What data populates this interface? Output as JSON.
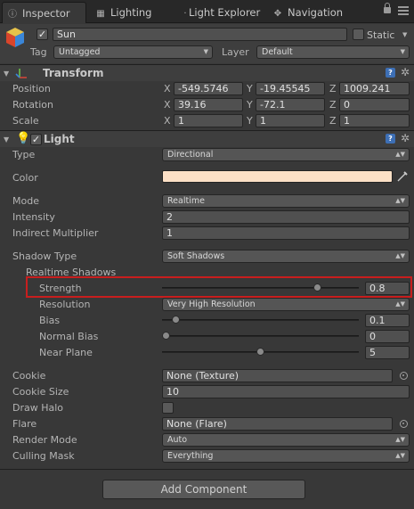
{
  "tabs": {
    "inspector": "Inspector",
    "lighting": "Lighting",
    "light_explorer": "Light Explorer",
    "navigation": "Navigation"
  },
  "object": {
    "name": "Sun",
    "active": true,
    "static_label": "Static",
    "static": false,
    "tag_label": "Tag",
    "tag_value": "Untagged",
    "layer_label": "Layer",
    "layer_value": "Default"
  },
  "transform": {
    "title": "Transform",
    "position_label": "Position",
    "rotation_label": "Rotation",
    "scale_label": "Scale",
    "axes": [
      "X",
      "Y",
      "Z"
    ],
    "position": [
      "-549.5746",
      "-19.45545",
      "1009.241"
    ],
    "rotation": [
      "39.16",
      "-72.1",
      "0"
    ],
    "scale": [
      "1",
      "1",
      "1"
    ]
  },
  "light": {
    "title": "Light",
    "enabled": true,
    "type_label": "Type",
    "type_value": "Directional",
    "color_label": "Color",
    "color_value": "#fce0c6",
    "mode_label": "Mode",
    "mode_value": "Realtime",
    "intensity_label": "Intensity",
    "intensity_value": "2",
    "indirect_label": "Indirect Multiplier",
    "indirect_value": "1",
    "shadow_type_label": "Shadow Type",
    "shadow_type_value": "Soft Shadows",
    "realtime_shadows_label": "Realtime Shadows",
    "strength_label": "Strength",
    "strength_value": "0.8",
    "strength_fraction": 0.8,
    "resolution_label": "Resolution",
    "resolution_value": "Very High Resolution",
    "bias_label": "Bias",
    "bias_value": "0.1",
    "bias_fraction": 0.05,
    "normal_bias_label": "Normal Bias",
    "normal_bias_value": "0",
    "normal_bias_fraction": 0,
    "near_plane_label": "Near Plane",
    "near_plane_value": "5",
    "near_plane_fraction": 0.5,
    "cookie_label": "Cookie",
    "cookie_value": "None (Texture)",
    "cookie_size_label": "Cookie Size",
    "cookie_size_value": "10",
    "draw_halo_label": "Draw Halo",
    "draw_halo": false,
    "flare_label": "Flare",
    "flare_value": "None (Flare)",
    "render_mode_label": "Render Mode",
    "render_mode_value": "Auto",
    "culling_mask_label": "Culling Mask",
    "culling_mask_value": "Everything"
  },
  "add_component_label": "Add Component",
  "colors": {
    "highlight": "#c81e1e",
    "help_icon": "#3d6fb5",
    "background": "#383838"
  }
}
